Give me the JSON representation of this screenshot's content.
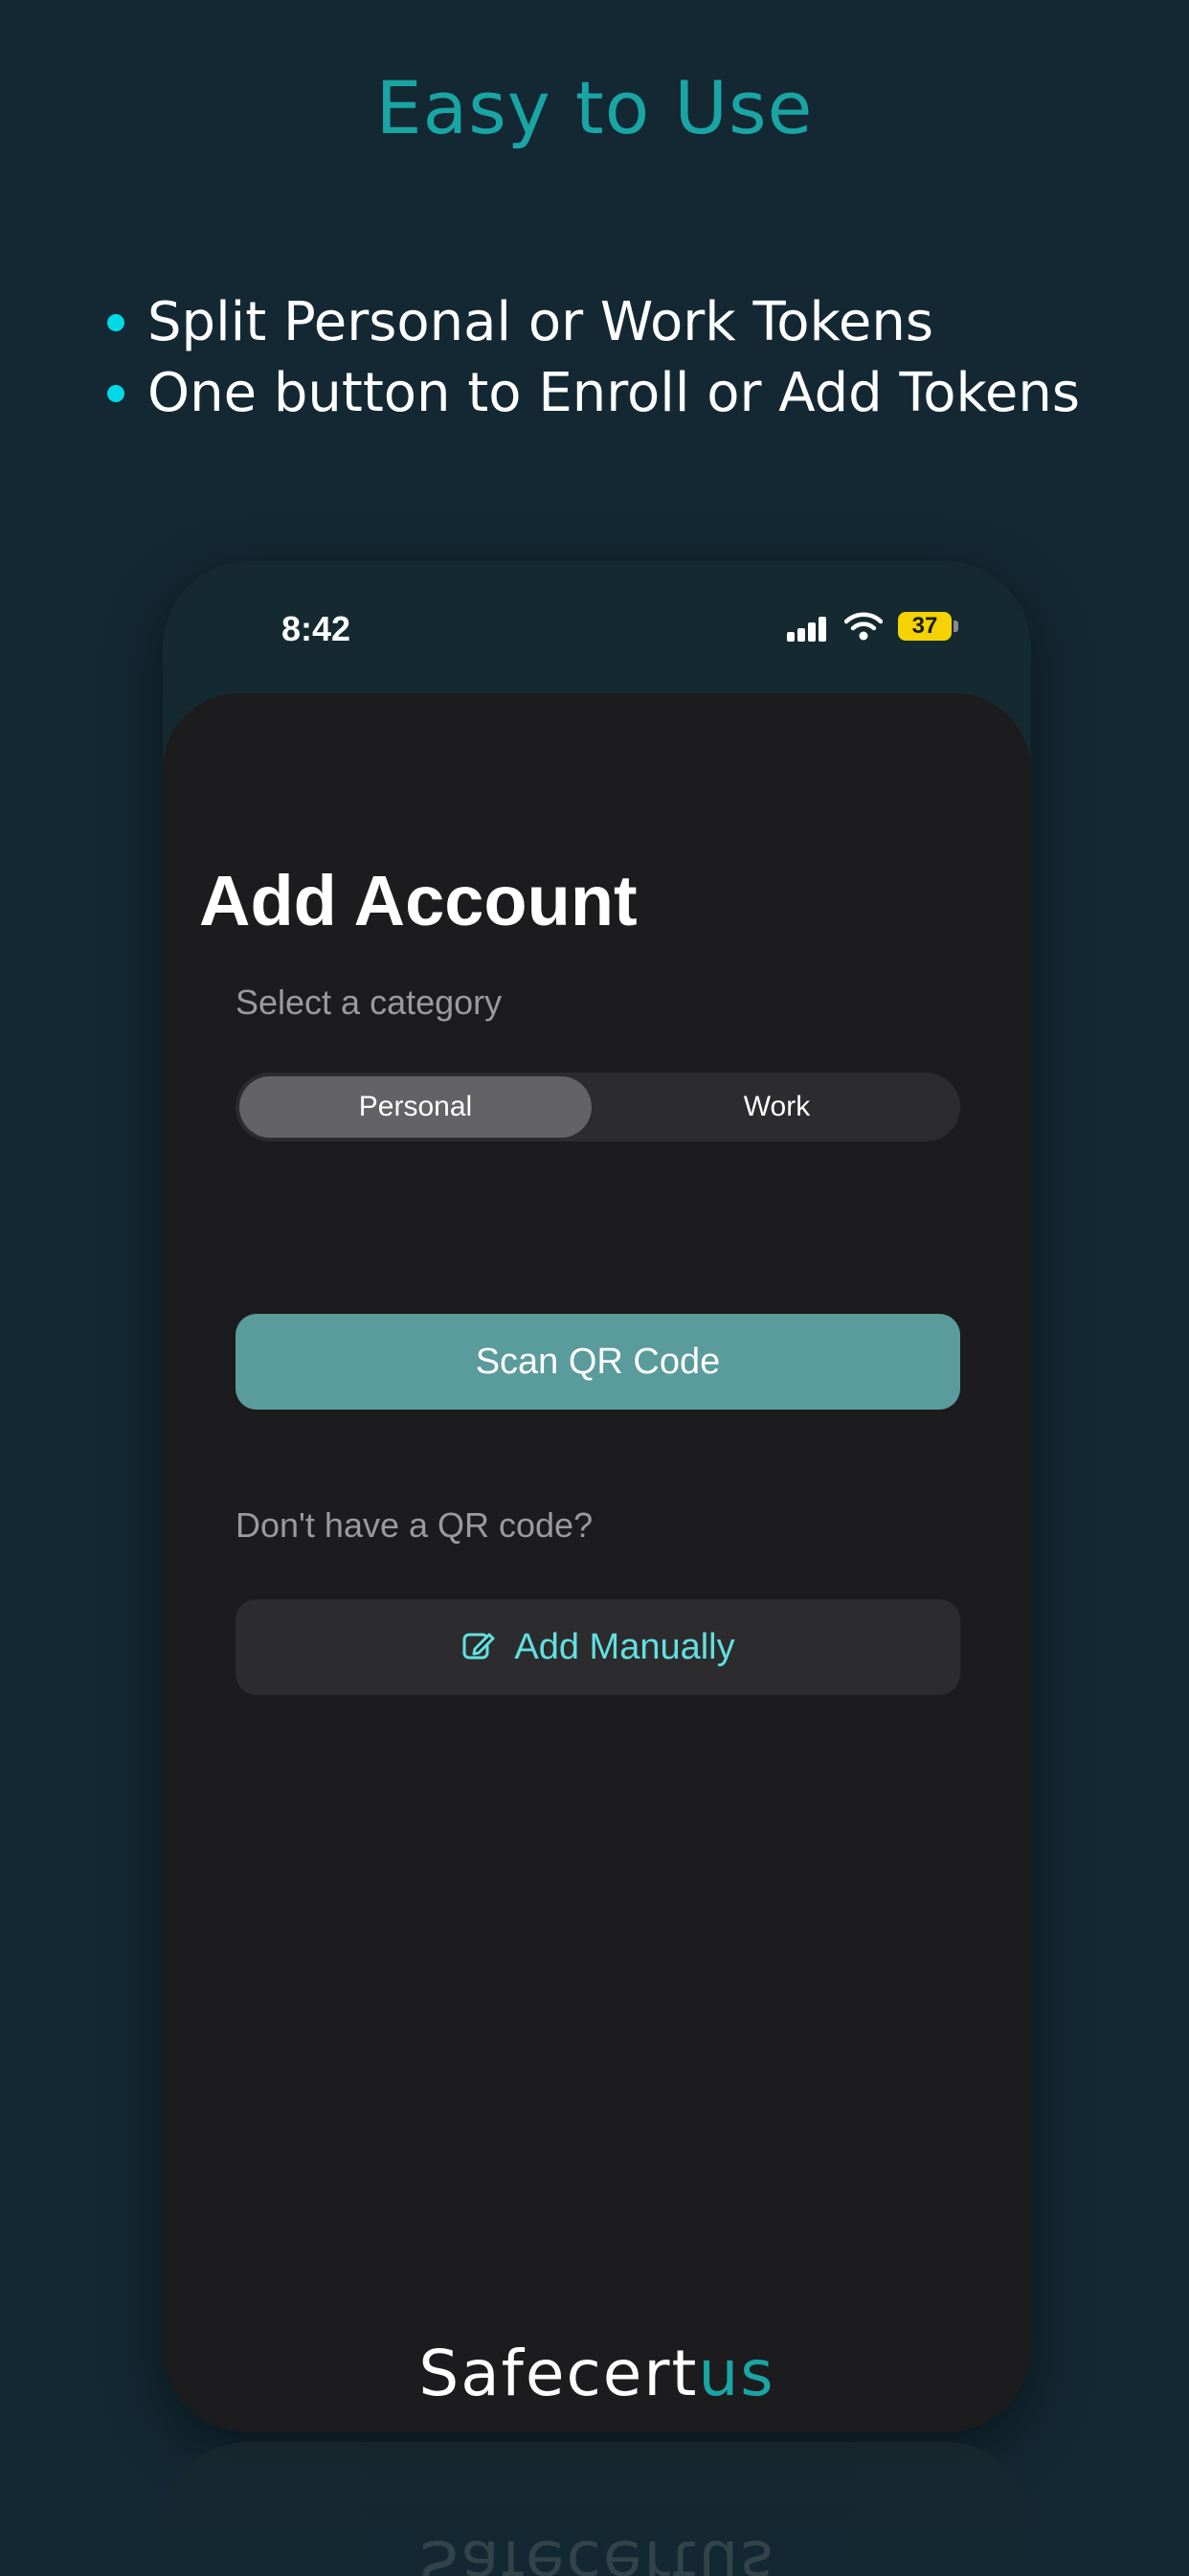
{
  "headline": "Easy to Use",
  "bullets": [
    "Split Personal or Work Tokens",
    "One button to Enroll or Add Tokens"
  ],
  "status_bar": {
    "time": "8:42",
    "battery": "37",
    "icons": [
      "signal-icon",
      "wifi-icon",
      "battery-icon"
    ]
  },
  "screen": {
    "title": "Add Account",
    "category_label": "Select a category",
    "segments": [
      "Personal",
      "Work"
    ],
    "selected_segment": "Personal",
    "scan_button": "Scan QR Code",
    "no_qr_label": "Don't have a QR code?",
    "manual_button": "Add Manually",
    "manual_icon": "edit-icon"
  },
  "brand": {
    "main": "Safecert",
    "accent": "us"
  },
  "colors": {
    "background": "#132833",
    "headline": "#1aa5a5",
    "bullet_dot": "#00d9e6",
    "screen": "#1c1c1e",
    "scan_button": "#5a9b9c",
    "manual_text": "#63e0e0",
    "battery": "#f5d300"
  }
}
